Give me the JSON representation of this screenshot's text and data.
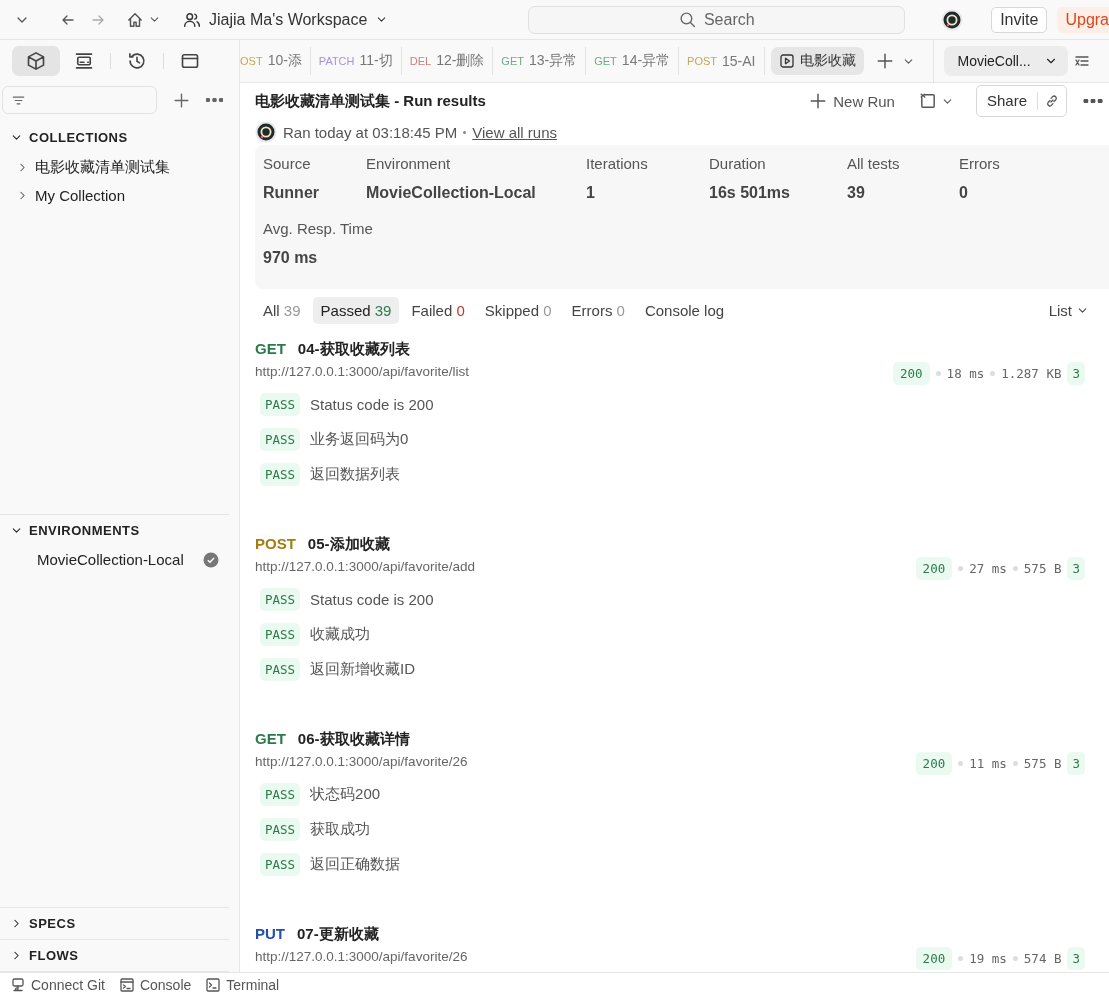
{
  "topbar": {
    "workspace": "Jiajia Ma's Workspace",
    "search_placeholder": "Search",
    "invite": "Invite",
    "upgrade": "Upgra"
  },
  "sidebar": {
    "tools": [
      {
        "kind": "collections",
        "selected": true
      },
      {
        "kind": "environments",
        "selected": false
      },
      {
        "kind": "history",
        "selected": false
      },
      {
        "kind": "files",
        "selected": false
      }
    ],
    "sections": [
      {
        "title": "COLLECTIONS",
        "expanded": true,
        "items": [
          {
            "label": "电影收藏清单测试集",
            "kind": "collection",
            "active": false
          },
          {
            "label": "My Collection",
            "kind": "collection",
            "active": false
          }
        ]
      },
      {
        "title": "ENVIRONMENTS",
        "expanded": true,
        "items": [
          {
            "label": "MovieCollection-Local",
            "kind": "environment",
            "active": true
          }
        ]
      },
      {
        "title": "SPECS",
        "expanded": false
      },
      {
        "title": "FLOWS",
        "expanded": false
      }
    ]
  },
  "tabs": [
    {
      "method": "OST",
      "kind": "post",
      "label": "10-添",
      "selected": false
    },
    {
      "method": "PATCH",
      "kind": "patch",
      "label": "11-切",
      "selected": false
    },
    {
      "method": "DEL",
      "kind": "del",
      "label": "12-删除",
      "selected": false
    },
    {
      "method": "GET",
      "kind": "get",
      "label": "13-异常",
      "selected": false
    },
    {
      "method": "GET",
      "kind": "get",
      "label": "14-异常",
      "selected": false
    },
    {
      "method": "POST",
      "kind": "post",
      "label": "15-AI",
      "selected": false
    },
    {
      "kind": "runner",
      "label": "电影收藏",
      "selected": true
    }
  ],
  "environment_select": "MovieColl...",
  "run": {
    "title": "电影收藏清单测试集 - Run results",
    "new_run": "New Run",
    "share": "Share",
    "ran_at": "Ran today at 03:18:45 PM",
    "view_all": "View all runs",
    "stats": [
      {
        "label": "Source",
        "value": "Runner"
      },
      {
        "label": "Environment",
        "value": "MovieCollection-Local"
      },
      {
        "label": "Iterations",
        "value": "1"
      },
      {
        "label": "Duration",
        "value": "16s 501ms"
      },
      {
        "label": "All tests",
        "value": "39"
      },
      {
        "label": "Errors",
        "value": "0"
      },
      {
        "label": "Avg. Resp. Time",
        "value": "970 ms"
      }
    ],
    "filters": [
      {
        "label": "All",
        "count": "39",
        "kind": "neutral",
        "selected": false
      },
      {
        "label": "Passed",
        "count": "39",
        "kind": "pass",
        "selected": true
      },
      {
        "label": "Failed",
        "count": "0",
        "kind": "fail",
        "selected": false
      },
      {
        "label": "Skipped",
        "count": "0",
        "kind": "neutral",
        "selected": false
      },
      {
        "label": "Errors",
        "count": "0",
        "kind": "neutral",
        "selected": false
      },
      {
        "label": "Console log",
        "kind": "plain",
        "selected": false
      }
    ],
    "view": "List",
    "results": [
      {
        "method": "GET",
        "kind": "get",
        "name": "04-获取收藏列表",
        "url": "http://127.0.0.1:3000/api/favorite/list",
        "status": "200",
        "time": "18 ms",
        "size": "1.287 KB",
        "count": "3",
        "tests": [
          {
            "result": "PASS",
            "name": "Status code is 200"
          },
          {
            "result": "PASS",
            "name": "业务返回码为0"
          },
          {
            "result": "PASS",
            "name": "返回数据列表"
          }
        ]
      },
      {
        "method": "POST",
        "kind": "post",
        "name": "05-添加收藏",
        "url": "http://127.0.0.1:3000/api/favorite/add",
        "status": "200",
        "time": "27 ms",
        "size": "575 B",
        "count": "3",
        "tests": [
          {
            "result": "PASS",
            "name": "Status code is 200"
          },
          {
            "result": "PASS",
            "name": "收藏成功"
          },
          {
            "result": "PASS",
            "name": "返回新增收藏ID"
          }
        ]
      },
      {
        "method": "GET",
        "kind": "get",
        "name": "06-获取收藏详情",
        "url": "http://127.0.0.1:3000/api/favorite/26",
        "status": "200",
        "time": "11 ms",
        "size": "575 B",
        "count": "3",
        "tests": [
          {
            "result": "PASS",
            "name": "状态码200"
          },
          {
            "result": "PASS",
            "name": "获取成功"
          },
          {
            "result": "PASS",
            "name": "返回正确数据"
          }
        ]
      },
      {
        "method": "PUT",
        "kind": "put",
        "name": "07-更新收藏",
        "url": "http://127.0.0.1:3000/api/favorite/26",
        "status": "200",
        "time": "19 ms",
        "size": "574 B",
        "count": "3"
      }
    ]
  },
  "status_bar": [
    {
      "kind": "git",
      "label": "Connect Git"
    },
    {
      "kind": "console",
      "label": "Console"
    },
    {
      "kind": "terminal",
      "label": "Terminal"
    }
  ]
}
